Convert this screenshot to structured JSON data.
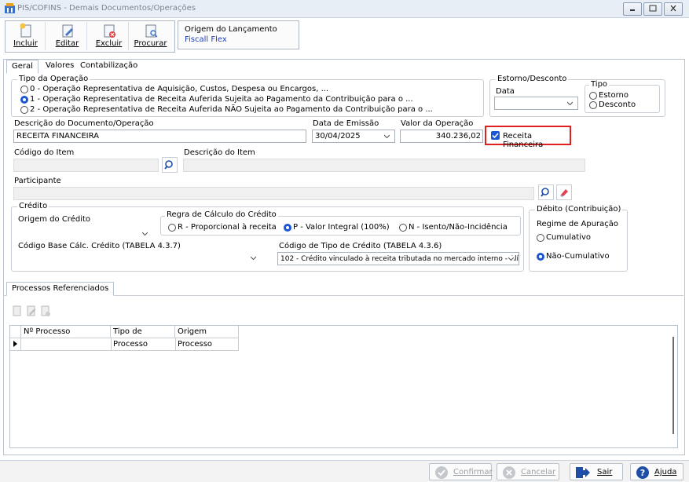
{
  "window": {
    "title": "PIS/COFINS - Demais Documentos/Operações"
  },
  "toolbar": {
    "incluir": "Incluir",
    "editar": "Editar",
    "excluir": "Excluir",
    "procurar": "Procurar"
  },
  "origem": {
    "label": "Origem do Lançamento",
    "value": "Fiscall Flex"
  },
  "tabs": [
    "Geral",
    "Valores",
    "Contabilização"
  ],
  "tipo_operacao": {
    "label": "Tipo da Operação",
    "options": [
      "0 - Operação Representativa de Aquisição, Custos, Despesa ou Encargos, ...",
      "1 - Operação Representativa de Receita Auferida Sujeita ao Pagamento da Contribuição para o ...",
      "2 - Operação Representativa de Receita Auferida NÃO Sujeita ao Pagamento da Contribuição para o ..."
    ],
    "selected": 1
  },
  "estorno": {
    "label": "Estorno/Desconto",
    "data_label": "Data",
    "data_value": "",
    "tipo_label": "Tipo",
    "opt_estorno": "Estorno",
    "opt_desconto": "Desconto"
  },
  "descricao": {
    "label": "Descrição do Documento/Operação",
    "value": "RECEITA FINANCEIRA"
  },
  "data_emissao": {
    "label": "Data de Emissão",
    "value": "30/04/2025"
  },
  "valor_operacao": {
    "label": "Valor da Operação",
    "value": "340.236,02"
  },
  "receita_financeira": {
    "label": "Receita Financeira",
    "checked": true
  },
  "item": {
    "codigo_label": "Código do Item",
    "descricao_label": "Descrição do Item"
  },
  "participante": {
    "label": "Participante"
  },
  "credito": {
    "label": "Crédito",
    "origem_label": "Origem do Crédito",
    "regra_label": "Regra de Cálculo do Crédito",
    "regra_r": "R - Proporcional à receita",
    "regra_p": "P - Valor Integral (100%)",
    "regra_n": "N - Isento/Não-Incidência",
    "base_label": "Código Base Cálc. Crédito (TABELA 4.3.7)",
    "tipo_label": "Código de Tipo de Crédito (TABELA 4.3.6)",
    "tipo_value": "102 - Crédito vinculado à receita tributada no mercado interno - Alíq"
  },
  "debito": {
    "label": "Débito (Contribuição)",
    "regime_label": "Regime de Apuração",
    "cumulativo": "Cumulativo",
    "nao_cumulativo": "Não-Cumulativo"
  },
  "processos": {
    "tab_label": "Processos Referenciados",
    "columns": [
      "Nº Processo",
      "Tipo de Processo",
      "Origem Processo"
    ]
  },
  "footer": {
    "confirmar": "Confirmar",
    "cancelar": "Cancelar",
    "sair": "Sair",
    "ajuda": "Ajuda"
  }
}
